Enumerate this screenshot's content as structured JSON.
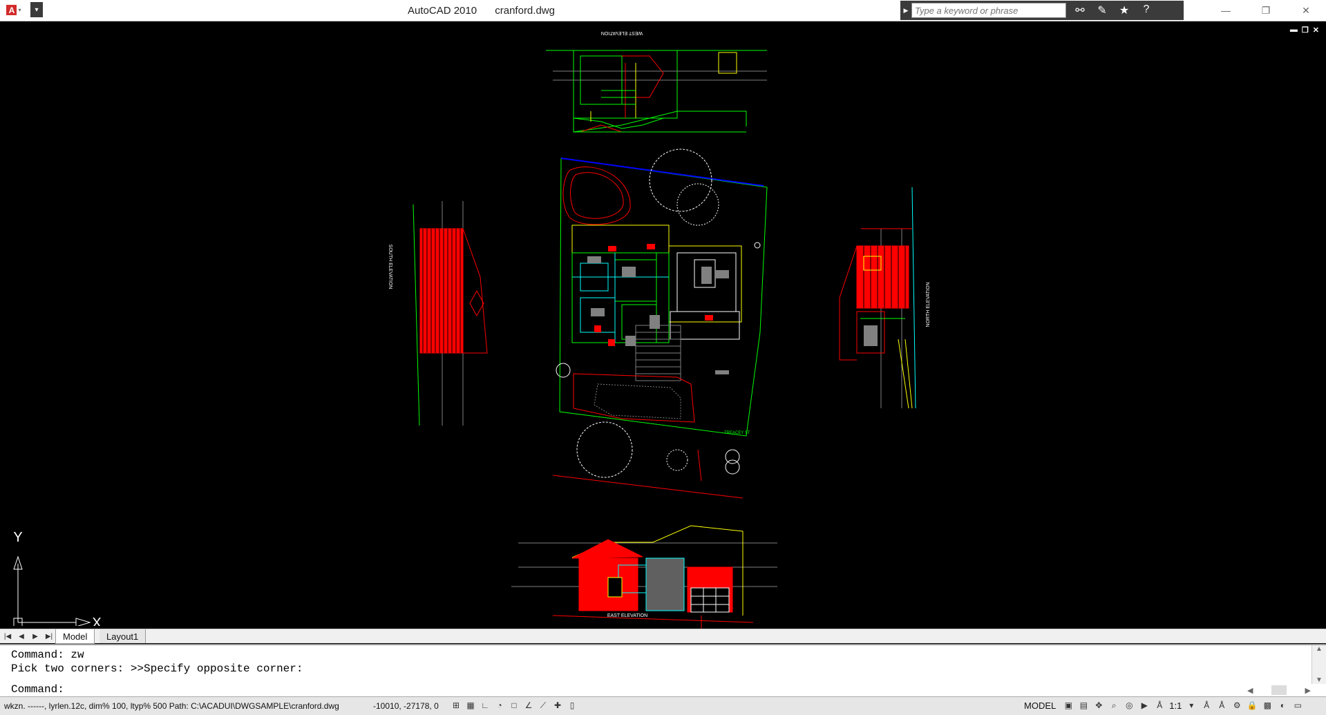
{
  "titlebar": {
    "app_name": "AutoCAD 2010",
    "file_name": "cranford.dwg",
    "search_placeholder": "Type a keyword or phrase",
    "logo_icon": "autocad-logo-icon",
    "icons": [
      "binoculars-icon",
      "communication-center-icon",
      "favorites-star-icon",
      "help-icon"
    ],
    "window_controls": [
      "minimize-icon",
      "restore-icon",
      "close-icon"
    ]
  },
  "drawing": {
    "labels": {
      "west": "WEST ELEVATION",
      "south": "SOUTH ELEVATION",
      "north": "NORTH ELEVATION",
      "east": "EAST ELEVATION",
      "street": "TREACEY ST"
    },
    "colors": {
      "background": "#000000",
      "red": "#ff0000",
      "green": "#00ff00",
      "yellow": "#ffff00",
      "cyan": "#00ffff",
      "blue": "#0000ff",
      "white": "#ffffff",
      "gray": "#808080"
    }
  },
  "ucs": {
    "x_label": "X",
    "y_label": "Y"
  },
  "tabs": {
    "nav_icons": [
      "first-tab-icon",
      "prev-tab-icon",
      "next-tab-icon",
      "last-tab-icon"
    ],
    "model": "Model",
    "layout1": "Layout1"
  },
  "command": {
    "history_line1": "Command: zw",
    "history_line2": "Pick two corners: >>Specify opposite corner:",
    "prompt": "Command:"
  },
  "status": {
    "path_text": "wkzn. ------, lyrlen.12c, dim% 100, ltyp% 500 Path: C:\\ACADUI\\DWGSAMPLE\\cranford.dwg",
    "coords": "-10010, -27178, 0",
    "model_label": "MODEL",
    "scale": "1:1",
    "toggle_icons": [
      "snap-icon",
      "grid-icon",
      "ortho-icon",
      "polar-icon",
      "osnap-icon",
      "otrack-icon",
      "ducs-icon",
      "dyn-icon",
      "lwt-icon",
      "qp-icon"
    ]
  }
}
